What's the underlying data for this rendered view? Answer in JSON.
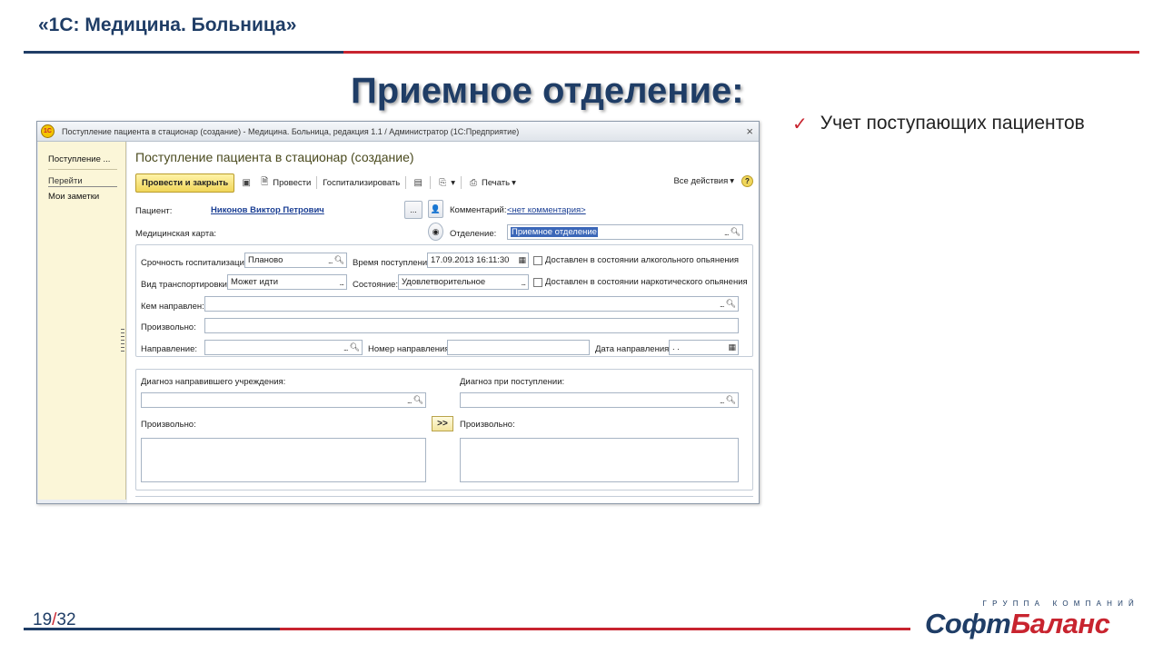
{
  "slide": {
    "header_title": "«1С: Медицина. Больница»",
    "heading": "Приемное отделение:",
    "bullet": "Учет поступающих пациентов",
    "page_current": "19",
    "page_sep": "/",
    "page_total": "32",
    "logo_tagline": "ГРУППА КОМПАНИЙ",
    "logo_part1": "Софт",
    "logo_part2": "Баланс",
    "colors": {
      "brand_blue": "#1f3d66",
      "brand_red": "#c8242f"
    }
  },
  "window": {
    "app_icon": "1С",
    "title": "Поступление пациента в стационар (создание) - Медицина. Больница, редакция 1.1 / Администратор  (1С:Предприятие)",
    "close": "×",
    "nav": {
      "current": "Поступление ...",
      "goto": "Перейти",
      "notes": "Мои заметки"
    },
    "form_title": "Поступление пациента в стационар (создание)",
    "toolbar": {
      "post_close": "Провести и закрыть",
      "post": "Провести",
      "hospitalize": "Госпитализировать",
      "print": "Печать",
      "all_actions": "Все действия",
      "help": "?"
    },
    "patient_label": "Пациент:",
    "patient_value": "Никонов Виктор Петрович",
    "comment_label": "Комментарий:",
    "comment_value": "<нет комментария>",
    "medcard_label": "Медицинская карта:",
    "department_label": "Отделение:",
    "department_value": "Приемное отделение",
    "urgency_label": "Срочность госпитализации:",
    "urgency_value": "Планово",
    "arrival_time_label": "Время поступления:",
    "arrival_time_value": "17.09.2013 16:11:30",
    "alcohol_label": "Доставлен в состоянии алкогольного опьянения",
    "transport_label": "Вид транспортировки:",
    "transport_value": "Может идти",
    "state_label": "Состояние:",
    "state_value": "Удовлетворительное",
    "narcotic_label": "Доставлен в состоянии наркотического опьянения",
    "referred_by_label": "Кем направлен:",
    "arbitrary_label": "Произвольно:",
    "referral_label": "Направление:",
    "referral_number_label": "Номер направления:",
    "referral_date_label": "Дата направления:",
    "referral_date_value": " .  .",
    "diag_referring_label": "Диагноз направившего учреждения:",
    "diag_admission_label": "Диагноз при поступлении:",
    "arbitrary_left_label": "Произвольно:",
    "arbitrary_right_label": "Произвольно:",
    "copy_button": ">>"
  }
}
